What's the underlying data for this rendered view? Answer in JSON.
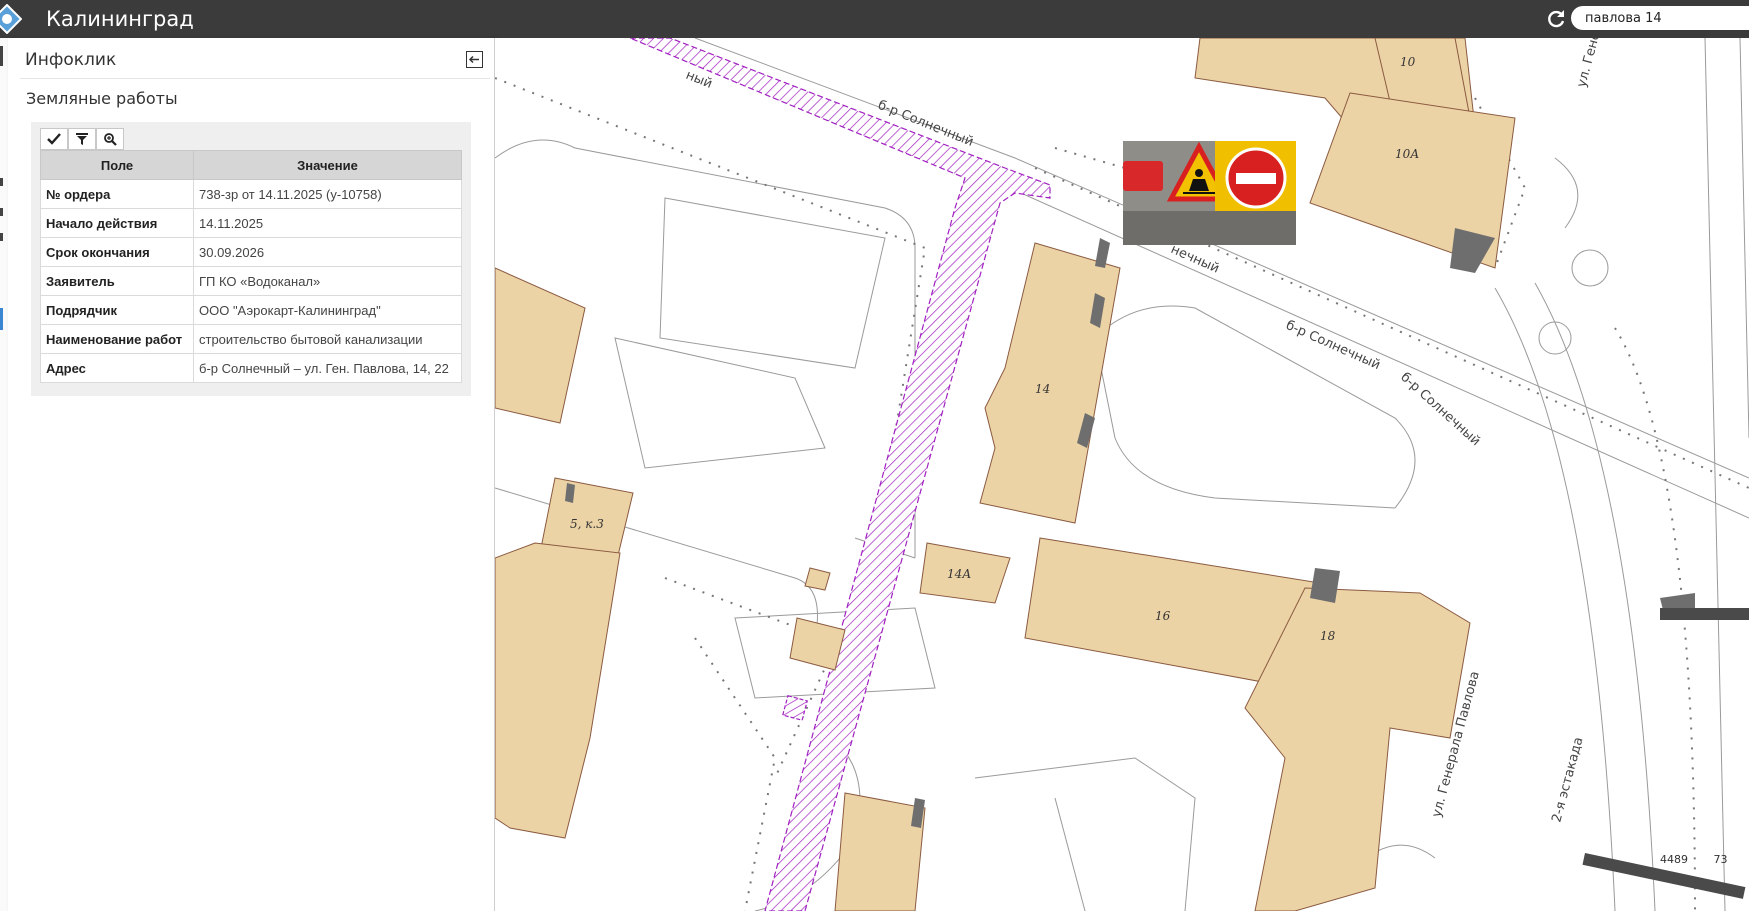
{
  "app": {
    "title": "Калининград"
  },
  "search": {
    "value": "павлова 14"
  },
  "panel": {
    "title": "Инфоклик",
    "layer_title": "Земляные работы",
    "table": {
      "headers": [
        "Поле",
        "Значение"
      ],
      "rows": [
        {
          "field": "№ ордера",
          "value": "738-зр от 14.11.2025 (у-10758)"
        },
        {
          "field": "Начало действия",
          "value": "14.11.2025"
        },
        {
          "field": "Срок окончания",
          "value": "30.09.2026"
        },
        {
          "field": "Заявитель",
          "value": "ГП КО «Водоканал»"
        },
        {
          "field": "Подрядчик",
          "value": "ООО \"Аэрокарт-Калининград\""
        },
        {
          "field": "Наименование работ",
          "value": "строительство бытовой канализации"
        },
        {
          "field": "Адрес",
          "value": "б-р Солнечный – ул. Ген. Павлова, 14, 22"
        }
      ]
    },
    "toolbar_icons": [
      "check-icon",
      "filter-icon",
      "zoom-icon"
    ]
  },
  "map": {
    "streets": {
      "solnechny_1": "б-р Солнечный",
      "solnechny_2": "нечный",
      "solnechny_3": "б-р Солнечный",
      "solnechny_4": "б-р Солнечный",
      "solnechny_top": "ный",
      "pavlova": "ул. Генерала Павлова",
      "estakada": "2-я эстакада",
      "generala_top": "ул. Генера"
    },
    "buildings": [
      "10",
      "10А",
      "14",
      "14А",
      "5, к.3",
      "16",
      "18"
    ],
    "scale_labels": [
      "4489",
      "73"
    ],
    "colors": {
      "building": "#ecd3a6",
      "hatch": "#a020c0",
      "topbar": "#3b3b3b"
    }
  }
}
